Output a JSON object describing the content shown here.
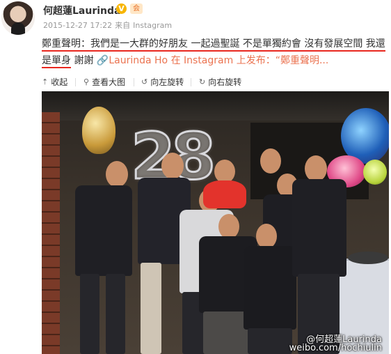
{
  "user": {
    "name": "何超蓮Laurinda",
    "verified_badge": "V",
    "member_badge": "会"
  },
  "meta": {
    "timestamp": "2015-12-27 17:22",
    "source_prefix": "来自",
    "source": "Instagram"
  },
  "post": {
    "part1": "鄭重聲明：我們是一大群的好朋友 一起過聖誕 不是單獨約會 沒有發展空間 我還",
    "part2": "是單身",
    "part3": " 謝謝 ",
    "link_icon": "🔗",
    "link_text": "Laurinda Ho 在 Instagram 上发布：“鄭重聲明..."
  },
  "toolbar": {
    "collapse_label": "收起",
    "view_large_label": "查看大图",
    "rotate_left_label": "向左旋转",
    "rotate_right_label": "向右旋转"
  },
  "photo": {
    "balloon_text": "28",
    "watermark_line1": "@何超蓮Laurinda",
    "watermark_line2": "weibo.com/hochiulin"
  },
  "colors": {
    "accent_underline": "#e8271e",
    "link": "#eb7350",
    "verified": "#f7b500"
  }
}
